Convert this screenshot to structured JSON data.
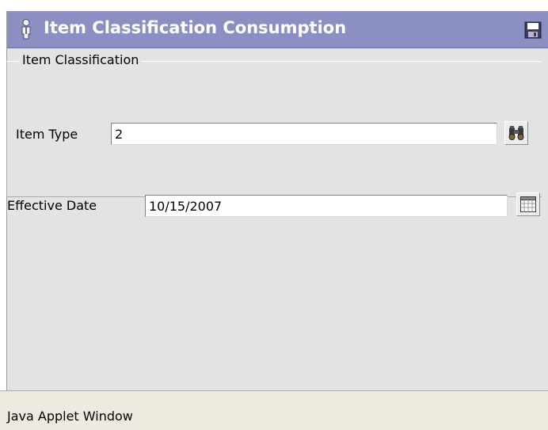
{
  "panel": {
    "title": "Item Classification Consumption",
    "title_icon": "user-icon",
    "save_icon": "save-icon"
  },
  "item_classification": {
    "legend": "Item Classification",
    "item_type_label": "Item Type",
    "item_type_value": "2",
    "lookup_icon": "binoculars-icon"
  },
  "effective_date": {
    "label": "Effective Date",
    "value": "10/15/2007",
    "calendar_icon": "calendar-icon"
  },
  "status_bar": {
    "text": "Java Applet Window"
  },
  "colors": {
    "title_bar": "#8b8fc2",
    "panel_background": "#e3e3e3",
    "status_background": "#edebe0"
  }
}
